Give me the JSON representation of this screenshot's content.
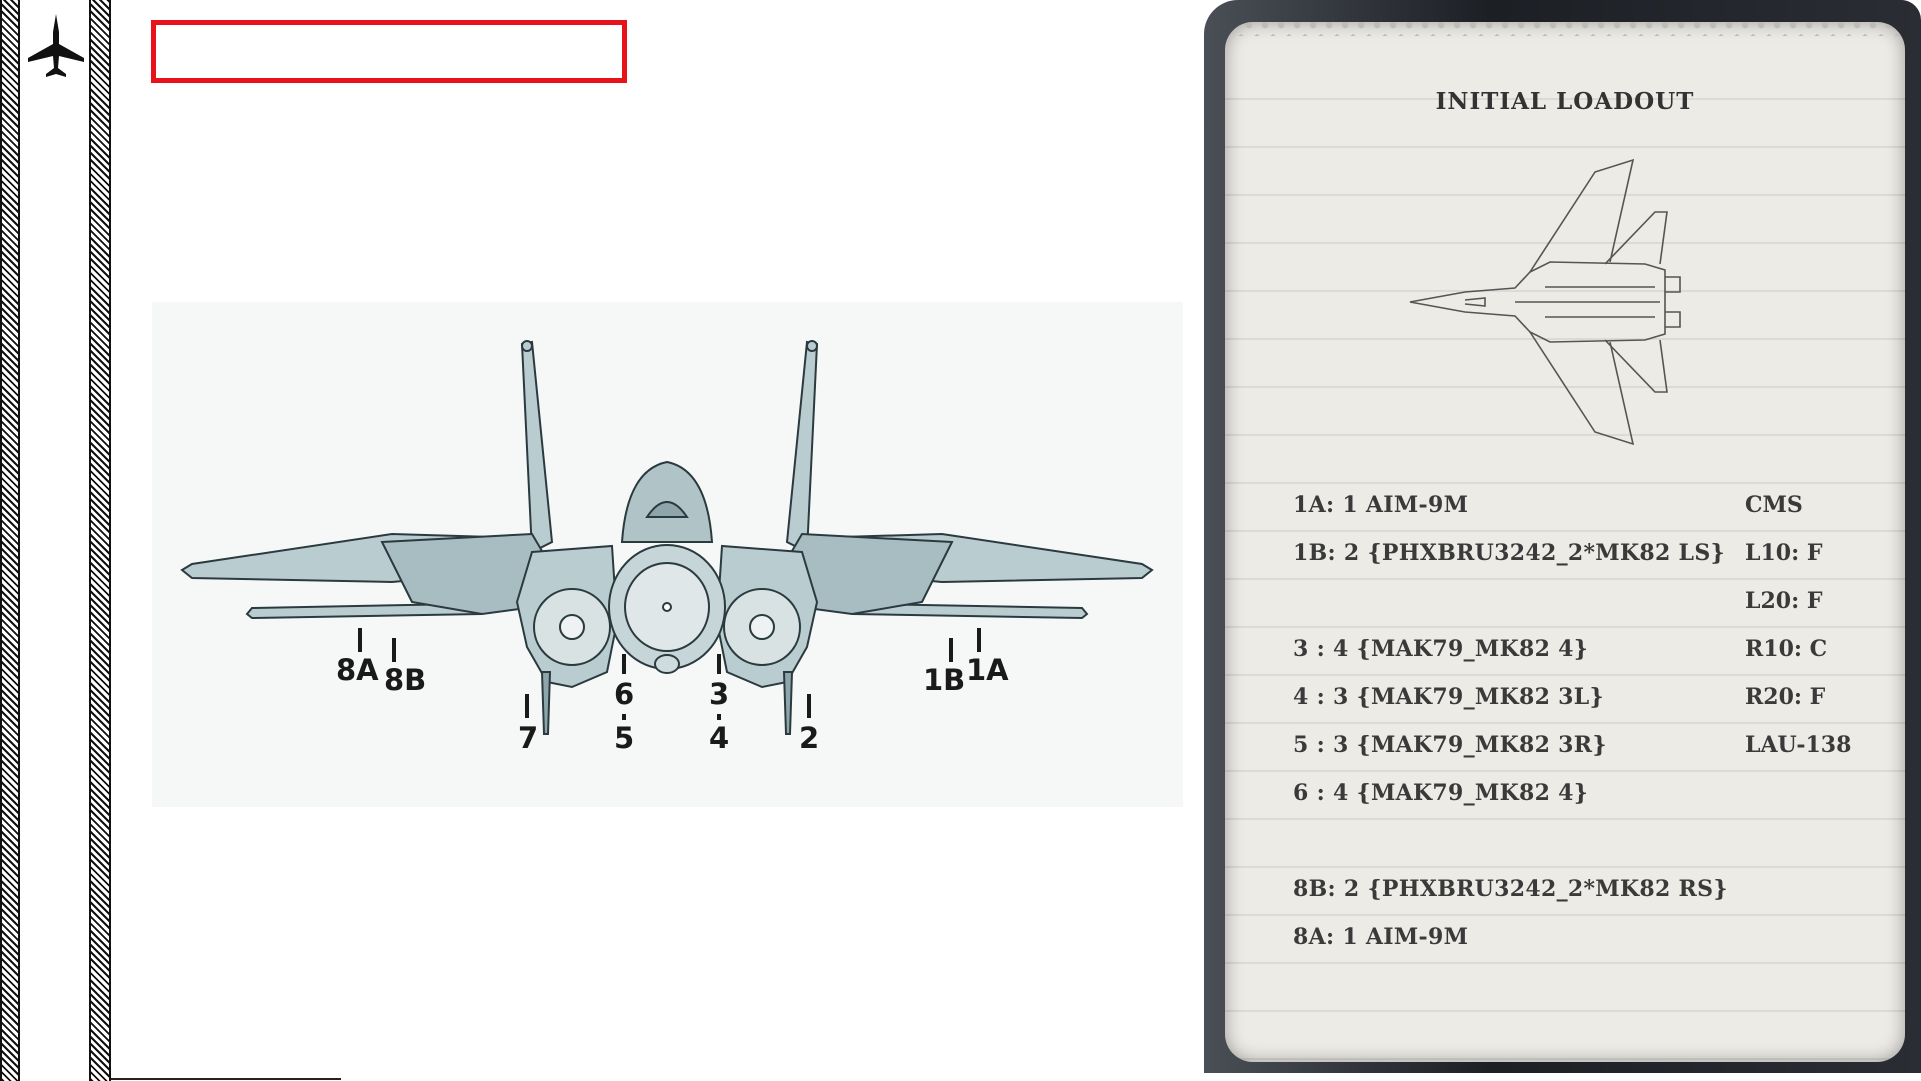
{
  "diagram": {
    "stations": [
      {
        "id": "8A",
        "label": "8A"
      },
      {
        "id": "8B",
        "label": "8B"
      },
      {
        "id": "7",
        "label": "7"
      },
      {
        "id": "6",
        "label": "6"
      },
      {
        "id": "5",
        "label": "5"
      },
      {
        "id": "3",
        "label": "3"
      },
      {
        "id": "4",
        "label": "4"
      },
      {
        "id": "2",
        "label": "2"
      },
      {
        "id": "1B",
        "label": "1B"
      },
      {
        "id": "1A",
        "label": "1A"
      }
    ]
  },
  "kneeboard": {
    "title": "INITIAL LOADOUT",
    "loadout": [
      "1A: 1 AIM-9M",
      "1B: 2 {PHXBRU3242_2*MK82 LS}",
      "3 : 4 {MAK79_MK82 4}",
      "4 : 3 {MAK79_MK82 3L}",
      "5 : 3 {MAK79_MK82 3R}",
      "6 : 4 {MAK79_MK82 4}",
      "8B: 2 {PHXBRU3242_2*MK82 RS}",
      "8A: 1 AIM-9M"
    ],
    "cms": [
      "CMS",
      "L10: F",
      "L20: F",
      "R10: C",
      "R20: F",
      "LAU-138"
    ]
  },
  "colors": {
    "highlight": "#e8121a",
    "aircraft_fill": "#b9cdd0",
    "aircraft_stroke": "#2a3a3e"
  },
  "icons": {
    "rail_logo": "jet-silhouette-icon",
    "kneeboard_aircraft": "f14-top-view-sketch"
  }
}
